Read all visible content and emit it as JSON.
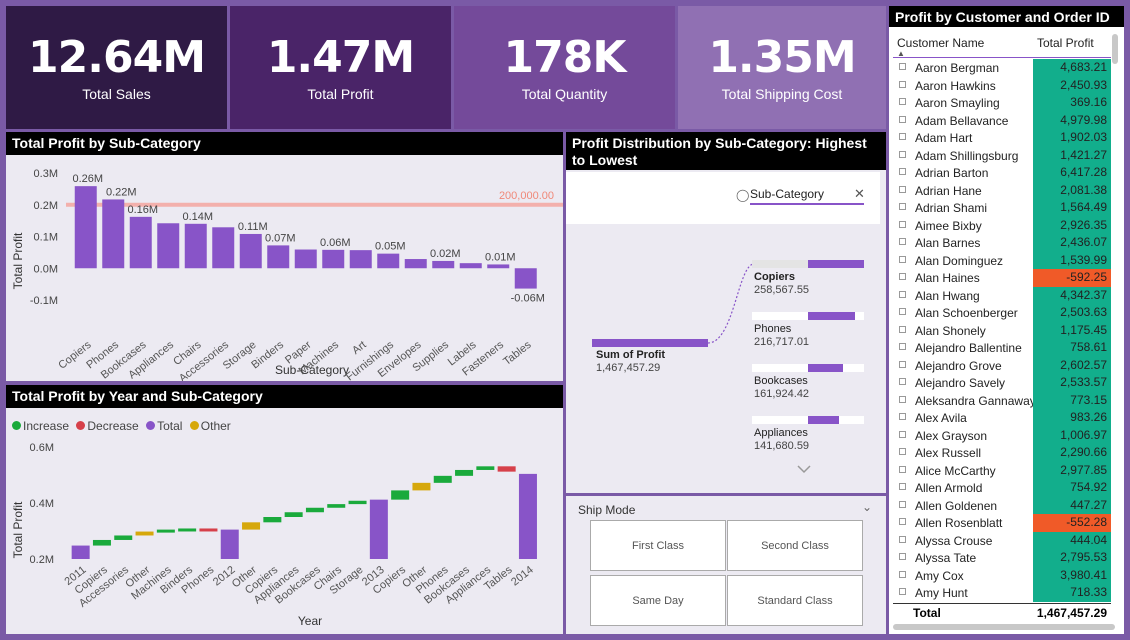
{
  "kpis": [
    {
      "value": "12.64M",
      "label": "Total Sales",
      "color": "#2f1a45"
    },
    {
      "value": "1.47M",
      "label": "Total Profit",
      "color": "#4a2468"
    },
    {
      "value": "178K",
      "label": "Total Quantity",
      "color": "#744a9a"
    },
    {
      "value": "1.35M",
      "label": "Total Shipping Cost",
      "color": "#9070b3"
    }
  ],
  "bar_panel": {
    "title": "Total Profit by Sub-Category",
    "xlabel": "Sub-Category",
    "ylabel": "Total Profit",
    "ref_label": "200,000.00"
  },
  "waterfall_panel": {
    "title": "Total Profit by Year and Sub-Category",
    "xlabel": "Year",
    "ylabel": "Total Profit",
    "legend": [
      {
        "label": "Increase",
        "color": "#1aaa3c"
      },
      {
        "label": "Decrease",
        "color": "#d6404a"
      },
      {
        "label": "Total",
        "color": "#8854c8"
      },
      {
        "label": "Other",
        "color": "#d6a80c"
      }
    ]
  },
  "decomp_panel": {
    "title": "Profit Distribution by Sub-Category: Highest to Lowest",
    "filter_label": "Sub-Category",
    "root_label": "Sum of Profit",
    "root_value": "1,467,457.29",
    "nodes": [
      {
        "name": "Copiers",
        "value": "258,567.55"
      },
      {
        "name": "Phones",
        "value": "216,717.01"
      },
      {
        "name": "Bookcases",
        "value": "161,924.42"
      },
      {
        "name": "Appliances",
        "value": "141,680.59"
      }
    ]
  },
  "ship_panel": {
    "title": "Ship Mode",
    "options": [
      "First Class",
      "Second Class",
      "Same Day",
      "Standard Class"
    ]
  },
  "table_panel": {
    "title": "Profit by Customer and Order ID",
    "col1": "Customer Name",
    "col2": "Total Profit",
    "total_label": "Total",
    "total_value": "1,467,457.29",
    "rows": [
      {
        "name": "Aaron Bergman",
        "value": "4,683.21",
        "neg": false
      },
      {
        "name": "Aaron Hawkins",
        "value": "2,450.93",
        "neg": false
      },
      {
        "name": "Aaron Smayling",
        "value": "369.16",
        "neg": false
      },
      {
        "name": "Adam Bellavance",
        "value": "4,979.98",
        "neg": false
      },
      {
        "name": "Adam Hart",
        "value": "1,902.03",
        "neg": false
      },
      {
        "name": "Adam Shillingsburg",
        "value": "1,421.27",
        "neg": false
      },
      {
        "name": "Adrian Barton",
        "value": "6,417.28",
        "neg": false
      },
      {
        "name": "Adrian Hane",
        "value": "2,081.38",
        "neg": false
      },
      {
        "name": "Adrian Shami",
        "value": "1,564.49",
        "neg": false
      },
      {
        "name": "Aimee Bixby",
        "value": "2,926.35",
        "neg": false
      },
      {
        "name": "Alan Barnes",
        "value": "2,436.07",
        "neg": false
      },
      {
        "name": "Alan Dominguez",
        "value": "1,539.99",
        "neg": false
      },
      {
        "name": "Alan Haines",
        "value": "-592.25",
        "neg": true
      },
      {
        "name": "Alan Hwang",
        "value": "4,342.37",
        "neg": false
      },
      {
        "name": "Alan Schoenberger",
        "value": "2,503.63",
        "neg": false
      },
      {
        "name": "Alan Shonely",
        "value": "1,175.45",
        "neg": false
      },
      {
        "name": "Alejandro Ballentine",
        "value": "758.61",
        "neg": false
      },
      {
        "name": "Alejandro Grove",
        "value": "2,602.57",
        "neg": false
      },
      {
        "name": "Alejandro Savely",
        "value": "2,533.57",
        "neg": false
      },
      {
        "name": "Aleksandra Gannaway",
        "value": "773.15",
        "neg": false
      },
      {
        "name": "Alex Avila",
        "value": "983.26",
        "neg": false
      },
      {
        "name": "Alex Grayson",
        "value": "1,006.97",
        "neg": false
      },
      {
        "name": "Alex Russell",
        "value": "2,290.66",
        "neg": false
      },
      {
        "name": "Alice McCarthy",
        "value": "2,977.85",
        "neg": false
      },
      {
        "name": "Allen Armold",
        "value": "754.92",
        "neg": false
      },
      {
        "name": "Allen Goldenen",
        "value": "447.27",
        "neg": false
      },
      {
        "name": "Allen Rosenblatt",
        "value": "-552.28",
        "neg": true
      },
      {
        "name": "Alyssa Crouse",
        "value": "444.04",
        "neg": false
      },
      {
        "name": "Alyssa Tate",
        "value": "2,795.53",
        "neg": false
      },
      {
        "name": "Amy Cox",
        "value": "3,980.41",
        "neg": false
      },
      {
        "name": "Amy Hunt",
        "value": "718.33",
        "neg": false
      }
    ]
  },
  "chart_data": [
    {
      "type": "bar",
      "title": "Total Profit by Sub-Category",
      "xlabel": "Sub-Category",
      "ylabel": "Total Profit",
      "categories": [
        "Copiers",
        "Phones",
        "Bookcases",
        "Appliances",
        "Chairs",
        "Accessories",
        "Storage",
        "Binders",
        "Paper",
        "Machines",
        "Art",
        "Furnishings",
        "Envelopes",
        "Supplies",
        "Labels",
        "Fasteners",
        "Tables"
      ],
      "values": [
        258567,
        216717,
        161924,
        141681,
        140000,
        129000,
        108000,
        72000,
        59000,
        58000,
        57000,
        46000,
        29000,
        23000,
        16000,
        12000,
        -64000
      ],
      "data_labels": [
        "0.26M",
        "0.22M",
        "0.16M",
        "",
        "0.14M",
        "",
        "0.11M",
        "0.07M",
        "",
        "0.06M",
        "",
        "0.05M",
        "",
        "0.02M",
        "",
        "0.01M",
        "-0.06M"
      ],
      "ylim": [
        -100000,
        300000
      ],
      "yticks": [
        "-0.1M",
        "0.0M",
        "0.1M",
        "0.2M",
        "0.3M"
      ],
      "reference_line": 200000,
      "color": "#8854c8"
    },
    {
      "type": "bar",
      "title": "Total Profit by Year and Sub-Category",
      "xlabel": "Year",
      "ylabel": "Total Profit",
      "categories": [
        "2011",
        "Copiers",
        "Accessories",
        "Other",
        "Machines",
        "Binders",
        "Phones",
        "2012",
        "Other",
        "Copiers",
        "Appliances",
        "Bookcases",
        "Chairs",
        "Storage",
        "2013",
        "Copiers",
        "Other",
        "Phones",
        "Bookcases",
        "Appliances",
        "Tables",
        "2014"
      ],
      "kinds": [
        "total",
        "increase",
        "increase",
        "other",
        "increase",
        "increase",
        "decrease",
        "total",
        "other",
        "increase",
        "increase",
        "increase",
        "increase",
        "increase",
        "total",
        "increase",
        "other",
        "increase",
        "increase",
        "increase",
        "decrease",
        "total"
      ],
      "values": [
        248000,
        20000,
        16000,
        14000,
        7000,
        4000,
        -4000,
        305000,
        26000,
        19000,
        17000,
        16000,
        13000,
        12000,
        412000,
        33000,
        27000,
        25000,
        21000,
        13000,
        -19000,
        504000
      ],
      "ylim": [
        200000,
        600000
      ],
      "yticks": [
        "0.2M",
        "0.4M",
        "0.6M"
      ]
    }
  ]
}
